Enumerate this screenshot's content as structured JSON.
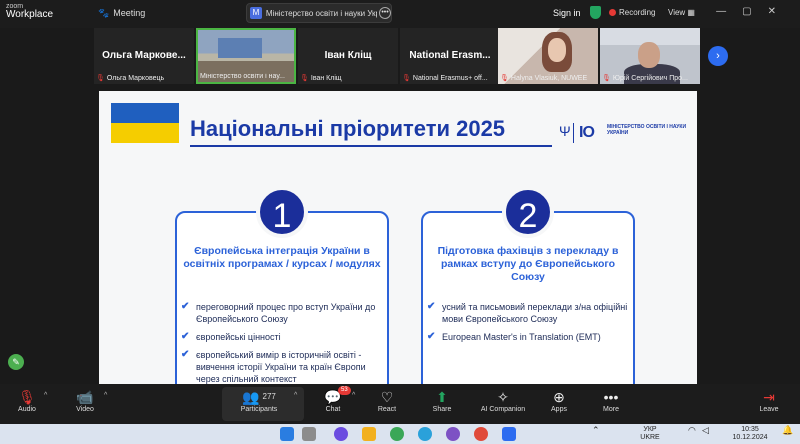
{
  "app": {
    "brand_top": "zoom",
    "brand_bottom": "Workplace",
    "meeting_label": "Meeting"
  },
  "title_tab": {
    "icon_letter": "M",
    "text": "Міністерство освіти і науки Укр"
  },
  "header": {
    "sign_in": "Sign in",
    "recording": "Recording",
    "view": "View"
  },
  "participants_strip": [
    {
      "display": "Ольга Маркове...",
      "caption": "Ольга Марковець",
      "type": "name"
    },
    {
      "display": "",
      "caption": "Міністерство освіти і нау...",
      "type": "room"
    },
    {
      "display": "Іван Кліщ",
      "caption": "Іван Кліщ",
      "type": "name"
    },
    {
      "display": "National Erasm...",
      "caption": "National Erasmus+ off...",
      "type": "name"
    },
    {
      "display": "",
      "caption": "Halyna Vlasiuk, NUWEE",
      "type": "face"
    },
    {
      "display": "",
      "caption": "Юрій Сергійович Про...",
      "type": "face2"
    }
  ],
  "slide": {
    "title": "Національні пріоритети 2025",
    "ministry_logo": "МІНІСТЕРСТВО ОСВІТИ І НАУКИ УКРАЇНИ",
    "cards": [
      {
        "number": "1",
        "title": "Європейська інтеграція України в освітніх програмах / курсах / модулях",
        "items": [
          "переговорний процес про вступ України до Європейського Союзу",
          "європейські цінності",
          "європейський вимір в історичній освіті - вивчення історії України та країн Європи через спільний контекст"
        ]
      },
      {
        "number": "2",
        "title": "Підготовка фахівців з перекладу в рамках вступу до Європейського Союзу",
        "items": [
          "усний та письмовий переклади з/на офіційні мови Європейського Союзу",
          "European Master's in Translation (EMT)"
        ]
      }
    ]
  },
  "toolbar": {
    "audio": "Audio",
    "video": "Video",
    "participants": "Participants",
    "participants_count": "277",
    "chat": "Chat",
    "chat_badge": "53",
    "react": "React",
    "share": "Share",
    "ai_companion": "AI Companion",
    "apps": "Apps",
    "more": "More",
    "leave": "Leave"
  },
  "taskbar": {
    "lang_top": "УКР",
    "lang_bottom": "UKRE",
    "time": "10:35",
    "date": "10.12.2024"
  },
  "colors": {
    "accent": "#2c62d8",
    "title_blue": "#1b3aa6",
    "badge_navy": "#1b2e9a",
    "flag_blue": "#1f5fbf",
    "flag_yellow": "#f5cd00",
    "record_red": "#e53935",
    "active_green": "#4bb543"
  }
}
